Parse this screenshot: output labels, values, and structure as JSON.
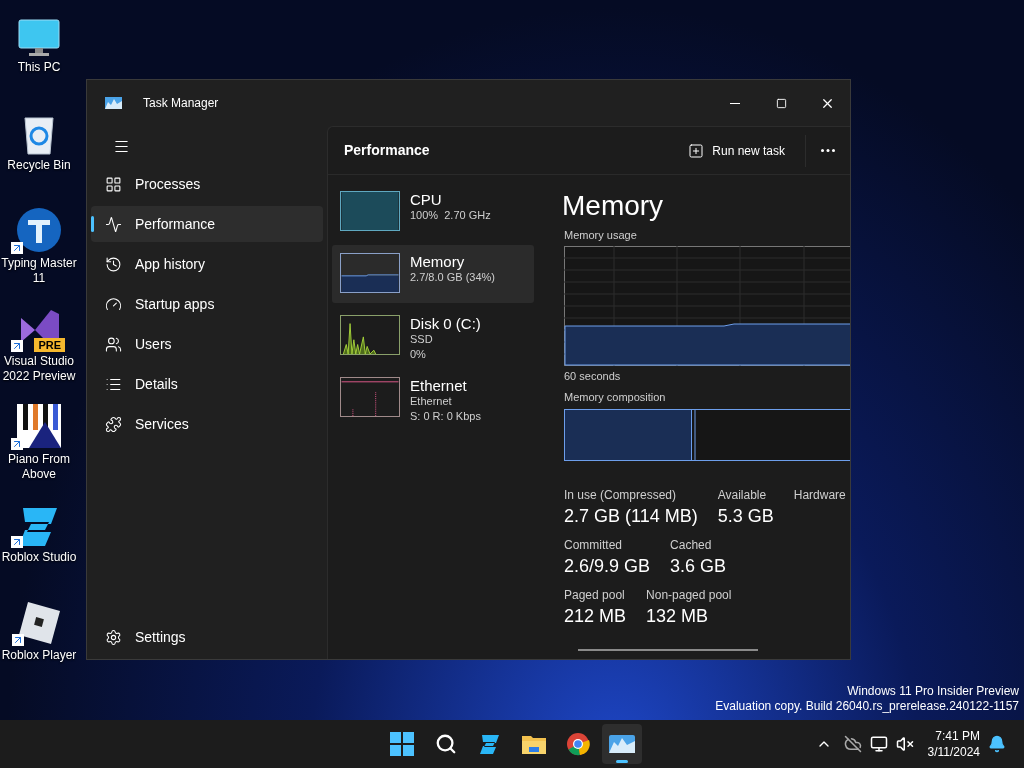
{
  "desktop_icons": [
    {
      "label": "This PC",
      "kind": "pc",
      "shortcut": false
    },
    {
      "label": "Recycle Bin",
      "kind": "bin",
      "shortcut": false
    },
    {
      "label": "Typing Master 11",
      "kind": "typing",
      "shortcut": true
    },
    {
      "label": "Visual Studio 2022 Preview",
      "kind": "vs",
      "shortcut": true,
      "badge": "PRE"
    },
    {
      "label": "Piano From Above",
      "kind": "piano",
      "shortcut": true
    },
    {
      "label": "Roblox Studio",
      "kind": "studio",
      "shortcut": true
    },
    {
      "label": "Roblox Player",
      "kind": "player",
      "shortcut": true
    }
  ],
  "window": {
    "title": "Task Manager",
    "nav": [
      {
        "label": "Processes",
        "kind": "processes",
        "selected": false
      },
      {
        "label": "Performance",
        "kind": "performance",
        "selected": true
      },
      {
        "label": "App history",
        "kind": "history",
        "selected": false
      },
      {
        "label": "Startup apps",
        "kind": "startup",
        "selected": false
      },
      {
        "label": "Users",
        "kind": "users",
        "selected": false
      },
      {
        "label": "Details",
        "kind": "details",
        "selected": false
      },
      {
        "label": "Services",
        "kind": "services",
        "selected": false
      }
    ],
    "settings": "Settings",
    "header": "Performance",
    "run_task": "Run new task",
    "devices": [
      {
        "name": "CPU",
        "kind": "cpu",
        "selected": false,
        "lines": [
          "100%  2.70 GHz"
        ]
      },
      {
        "name": "Memory",
        "kind": "memory",
        "selected": true,
        "lines": [
          "2.7/8.0 GB (34%)"
        ]
      },
      {
        "name": "Disk 0 (C:)",
        "kind": "disk",
        "selected": false,
        "lines": [
          "SSD",
          "0%"
        ]
      },
      {
        "name": "Ethernet",
        "kind": "ethernet",
        "selected": false,
        "lines": [
          "Ethernet",
          "S: 0 R: 0 Kbps"
        ]
      }
    ],
    "detail": {
      "title": "Memory",
      "usage_label": "Memory usage",
      "time_label": "60 seconds",
      "composition_label": "Memory composition",
      "stats": [
        [
          {
            "label": "In use (Compressed)",
            "value": "2.7 GB (114 MB)"
          },
          {
            "label": "Available",
            "value": "5.3 GB"
          },
          {
            "label": "Hardware"
          }
        ],
        [
          {
            "label": "Committed",
            "value": "2.6/9.9 GB"
          },
          {
            "label": "Cached",
            "value": "3.6 GB"
          }
        ],
        [
          {
            "label": "Paged pool",
            "value": "212 MB"
          },
          {
            "label": "Non-paged pool",
            "value": "132 MB"
          }
        ]
      ]
    }
  },
  "watermark": [
    "Windows 11 Pro Insider Preview",
    "Evaluation copy. Build 26040.rs_prerelease.240122-1157"
  ],
  "taskbar": {
    "time": "7:41 PM",
    "date": "3/11/2024"
  }
}
